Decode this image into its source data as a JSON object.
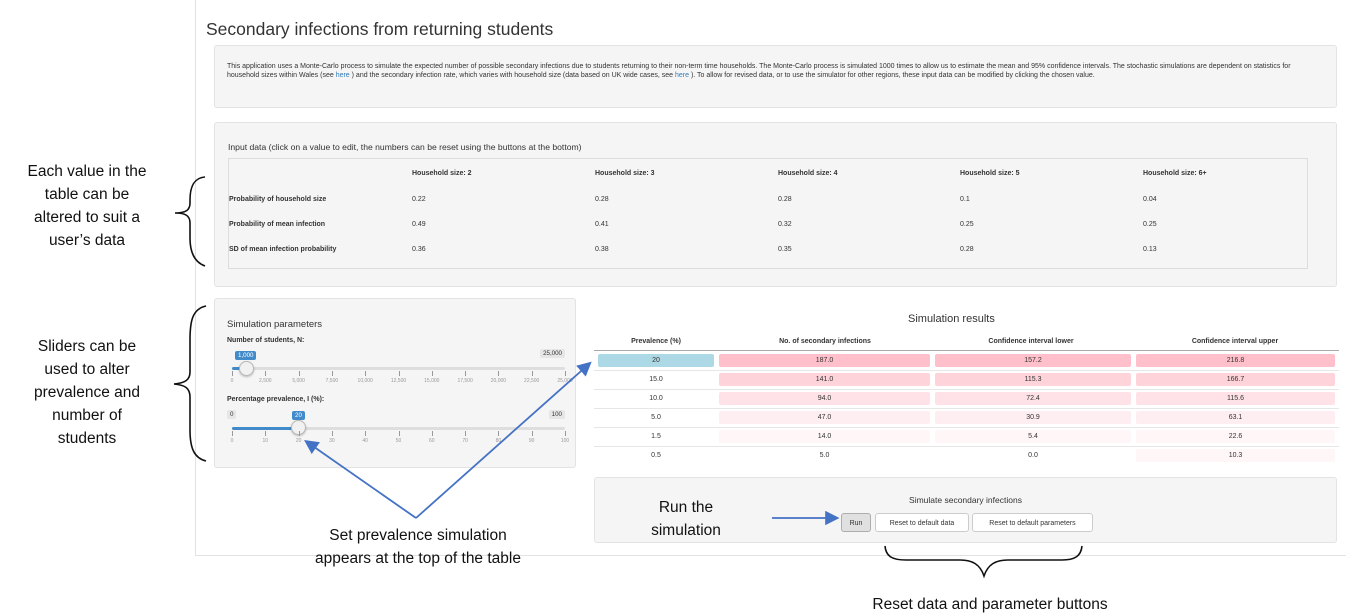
{
  "app": {
    "title": "Secondary infections from returning students",
    "intro": {
      "part1": "This application uses a Monte-Carlo process to simulate the expected number of possible secondary infections due to students returning to their non-term time households. The Monte-Carlo process is simulated 1000 times to allow us to estimate the mean and 95% confidence intervals. The stochastic simulations are dependent on statistics for household sizes within Wales (see ",
      "link1": "here",
      "part2": " ) and the secondary infection rate, which varies with household size (data based on UK wide cases, see ",
      "link2": "here",
      "part3": " ). To allow for revised data, or to use the simulator for other regions, these input data can be modified by clicking the chosen value."
    }
  },
  "input_data": {
    "title": "Input data (click on a value to edit, the numbers can be reset using the buttons at the bottom)",
    "columns": [
      "Household size: 2",
      "Household size: 3",
      "Household size: 4",
      "Household size: 5",
      "Household size: 6+"
    ],
    "rows": [
      {
        "label": "Probability of household size",
        "values": [
          "0.22",
          "0.28",
          "0.28",
          "0.1",
          "0.04"
        ]
      },
      {
        "label": "Probability of mean infection",
        "values": [
          "0.49",
          "0.41",
          "0.32",
          "0.25",
          "0.25"
        ]
      },
      {
        "label": "SD of mean infection probability",
        "values": [
          "0.36",
          "0.38",
          "0.35",
          "0.28",
          "0.13"
        ]
      }
    ]
  },
  "simulation_parameters": {
    "title": "Simulation parameters",
    "students": {
      "label": "Number of students, N:",
      "value": "1,000",
      "numeric_value": 1000,
      "min": 0,
      "max_label": "25,000",
      "max": 25000,
      "ticks": [
        "0",
        "2,500",
        "5,000",
        "7,500",
        "10,000",
        "12,500",
        "15,000",
        "17,500",
        "20,000",
        "22,500",
        "25,000"
      ]
    },
    "prevalence": {
      "label": "Percentage prevalence, I (%):",
      "value": "20",
      "numeric_value": 20,
      "min_label": "0",
      "min": 0,
      "max_label": "100",
      "max": 100,
      "ticks": [
        "0",
        "10",
        "20",
        "30",
        "40",
        "50",
        "60",
        "70",
        "80",
        "90",
        "100"
      ]
    }
  },
  "results": {
    "title": "Simulation results",
    "columns": [
      "Prevalence (%)",
      "No. of secondary infections",
      "Confidence interval lower",
      "Confidence interval upper"
    ],
    "rows": [
      [
        "20",
        "187.0",
        "157.2",
        "216.8"
      ],
      [
        "15.0",
        "141.0",
        "115.3",
        "166.7"
      ],
      [
        "10.0",
        "94.0",
        "72.4",
        "115.6"
      ],
      [
        "5.0",
        "47.0",
        "30.9",
        "63.1"
      ],
      [
        "1.5",
        "14.0",
        "5.4",
        "22.6"
      ],
      [
        "0.5",
        "5.0",
        "0.0",
        "10.3"
      ]
    ],
    "colors": {
      "highlight": "#add8e6",
      "heat_1": "#ffc0cb",
      "heat_2": "#ffd3da",
      "heat_3": "#ffe2e7",
      "heat_4": "#ffeef1",
      "heat_5": "#fff6f8"
    }
  },
  "run_panel": {
    "title": "Simulate secondary infections",
    "run_label": "Run",
    "reset_data_label": "Reset to default data",
    "reset_params_label": "Reset to default parameters"
  },
  "annotations": {
    "table": [
      "Each value in the",
      "table can be",
      "altered to suit a",
      "user’s data"
    ],
    "sliders": [
      "Sliders can be",
      "used to alter",
      "prevalence and",
      "number of",
      "students"
    ],
    "prevalence": [
      "Set prevalence simulation",
      "appears at the top of the table"
    ],
    "run": [
      "Run the",
      "simulation"
    ],
    "reset": "Reset data and parameter buttons",
    "arrow_color": "#4472c4"
  }
}
